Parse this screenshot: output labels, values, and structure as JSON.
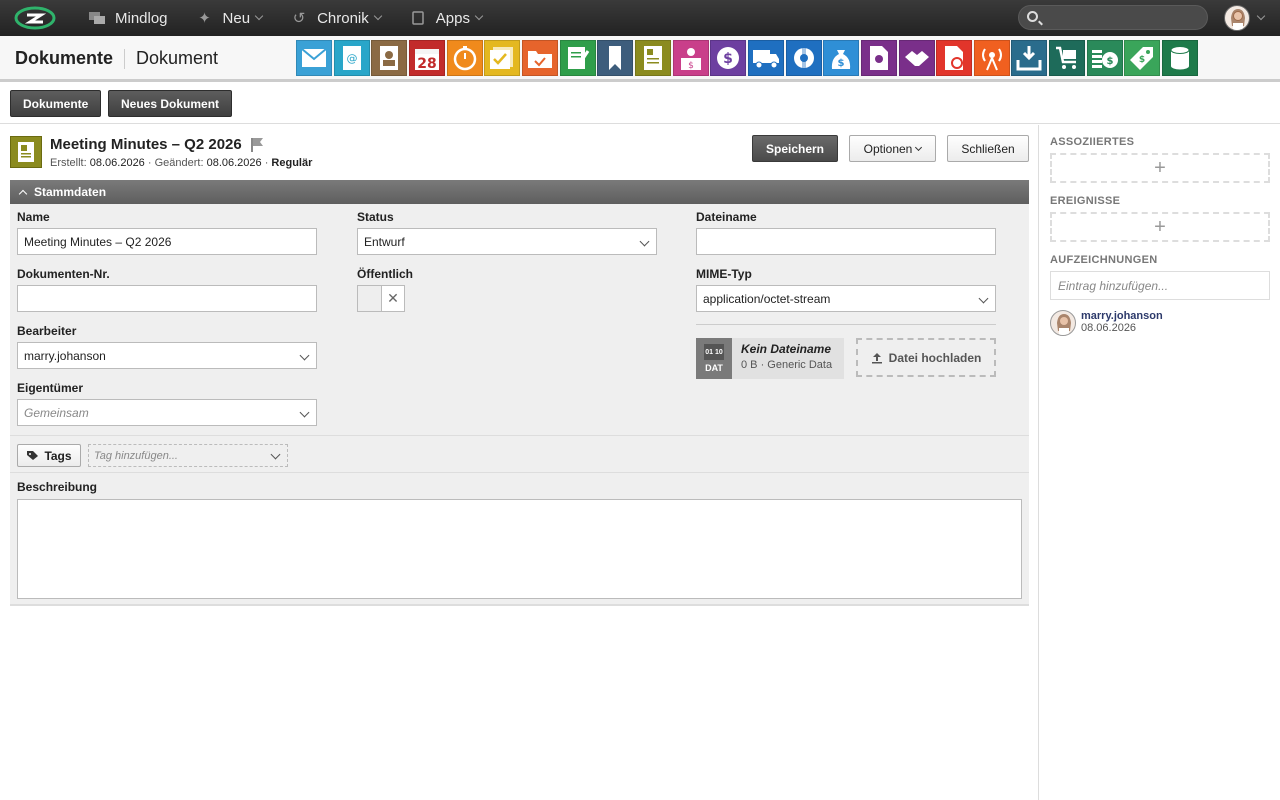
{
  "topbar": {
    "nav": [
      {
        "label": "Mindlog",
        "icon": "chat-icon"
      },
      {
        "label": "Neu",
        "icon": "sparkle-icon"
      },
      {
        "label": "Chronik",
        "icon": "history-icon"
      },
      {
        "label": "Apps",
        "icon": "tablet-icon"
      }
    ],
    "search_placeholder": ""
  },
  "breadcrumb": {
    "root": "Dokumente",
    "current": "Dokument"
  },
  "app_icons": [
    {
      "name": "email",
      "color": "#3aa1d6"
    },
    {
      "name": "address-book",
      "color": "#29a6c9"
    },
    {
      "name": "contacts",
      "color": "#8b6a44"
    },
    {
      "name": "calendar",
      "color": "#c22b2b",
      "text": "28"
    },
    {
      "name": "timer",
      "color": "#f08a1c"
    },
    {
      "name": "tasks",
      "color": "#e4b820"
    },
    {
      "name": "projects",
      "color": "#e6642c"
    },
    {
      "name": "notes",
      "color": "#2f9e4a"
    },
    {
      "name": "bookmarks",
      "color": "#3d5d7c"
    },
    {
      "name": "documents",
      "color": "#8b8b1f"
    },
    {
      "name": "presentations",
      "color": "#c93f8a"
    },
    {
      "name": "finance",
      "color": "#6d3fa0"
    },
    {
      "name": "shipping",
      "color": "#1f6fc0"
    },
    {
      "name": "support",
      "color": "#1f6fc0"
    },
    {
      "name": "money-bag",
      "color": "#2f8fd6"
    },
    {
      "name": "licenses",
      "color": "#7a2f8a"
    },
    {
      "name": "deals",
      "color": "#7a2f8a"
    },
    {
      "name": "contracts",
      "color": "#e2352b"
    },
    {
      "name": "broadcast",
      "color": "#f06020"
    },
    {
      "name": "inbox",
      "color": "#2a6c8c"
    },
    {
      "name": "cart",
      "color": "#1e6b5a"
    },
    {
      "name": "cash",
      "color": "#2a8a5a"
    },
    {
      "name": "tags",
      "color": "#3aa55a"
    },
    {
      "name": "database",
      "color": "#1e7a4a"
    }
  ],
  "action_buttons": {
    "documents": "Dokumente",
    "new_document": "Neues Dokument"
  },
  "document": {
    "title": "Meeting Minutes – Q2 2026",
    "created_label": "Erstellt:",
    "created": "08.06.2026",
    "changed_label": "Geändert:",
    "changed": "08.06.2026",
    "type": "Regulär"
  },
  "header_buttons": {
    "save": "Speichern",
    "options": "Optionen",
    "close": "Schließen"
  },
  "section": {
    "title": "Stammdaten"
  },
  "form": {
    "name_label": "Name",
    "name_value": "Meeting Minutes – Q2 2026",
    "docnr_label": "Dokumenten-Nr.",
    "docnr_value": "",
    "editor_label": "Bearbeiter",
    "editor_value": "marry.johanson",
    "owner_label": "Eigentümer",
    "owner_placeholder": "Gemeinsam",
    "status_label": "Status",
    "status_value": "Entwurf",
    "public_label": "Öffentlich",
    "filename_label": "Dateiname",
    "filename_value": "",
    "mime_label": "MIME-Typ",
    "mime_value": "application/octet-stream",
    "file": {
      "badge": "DAT",
      "bin": "01 10",
      "name": "Kein Dateiname",
      "size": "0 B · Generic Data"
    },
    "upload_label": "Datei hochladen",
    "tags_label": "Tags",
    "tags_placeholder": "Tag hinzufügen...",
    "description_label": "Beschreibung"
  },
  "sidebar": {
    "associated": "ASSOZIIERTES",
    "events": "EREIGNISSE",
    "records": "AUFZEICHNUNGEN",
    "record_placeholder": "Eintrag hinzufügen...",
    "record_user": "marry.johanson",
    "record_date": "08.06.2026"
  }
}
